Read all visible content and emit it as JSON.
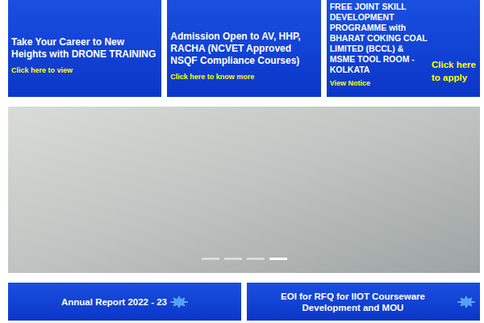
{
  "banners": [
    {
      "title": "Take Your Career to New Heights with DRONE TRAINING",
      "link": "Click here to view"
    },
    {
      "title": "Admission Open to AV, HHP, RACHA (NCVET Approved NSQF Compliance Courses)",
      "link": "Click here to know more"
    },
    {
      "title": "FREE JOINT SKILL DEVELOPMENT PROGRAMME with BHARAT COKING COAL LIMITED (BCCL) & MSME TOOL ROOM - KOLKATA",
      "link": "View Notice",
      "action": "Click here to apply"
    }
  ],
  "carousel": {
    "indicators": [
      {
        "selected": false
      },
      {
        "selected": false
      },
      {
        "selected": false
      },
      {
        "selected": true
      }
    ]
  },
  "links": [
    {
      "label": "Annual Report 2022 - 23"
    },
    {
      "label": "EOI for RFQ for IIOT Courseware Development and MOU"
    }
  ]
}
